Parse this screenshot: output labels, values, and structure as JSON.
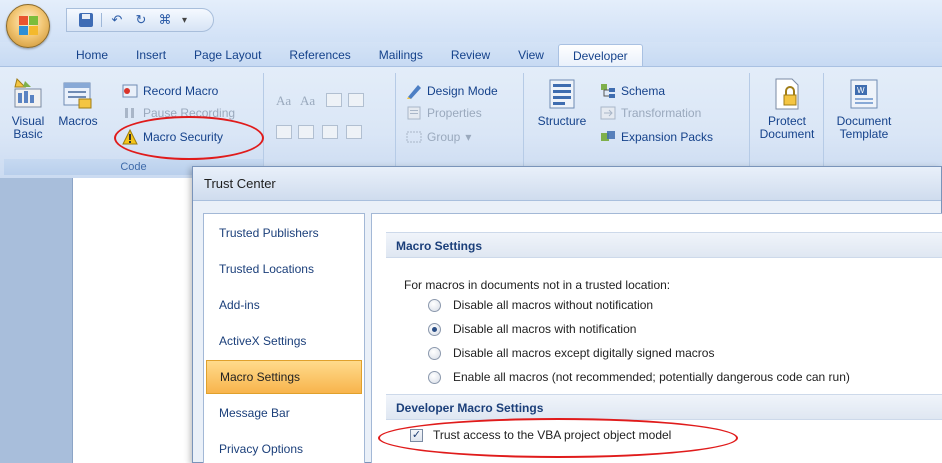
{
  "quick_access": {
    "items": [
      "save-icon",
      "undo-icon",
      "redo-icon",
      "macro-icon"
    ],
    "dropdown": "▾"
  },
  "tabs": [
    "Home",
    "Insert",
    "Page Layout",
    "References",
    "Mailings",
    "Review",
    "View",
    "Developer"
  ],
  "active_tab": "Developer",
  "ribbon": {
    "code": {
      "visual_basic": "Visual Basic",
      "macros": "Macros",
      "record_macro": "Record Macro",
      "pause_recording": "Pause Recording",
      "macro_security": "Macro Security",
      "label": "Code"
    },
    "controls": {
      "design_mode": "Design Mode",
      "properties": "Properties",
      "group": "Group",
      "aa1": "Aa",
      "aa2": "Aa"
    },
    "xml": {
      "structure": "Structure",
      "schema": "Schema",
      "transformation": "Transformation",
      "expansion_packs": "Expansion Packs"
    },
    "protect": {
      "protect_document_line1": "Protect",
      "protect_document_line2": "Document"
    },
    "templates": {
      "document_template_line1": "Document",
      "document_template_line2": "Template"
    }
  },
  "dialog": {
    "title": "Trust Center",
    "nav": [
      "Trusted Publishers",
      "Trusted Locations",
      "Add-ins",
      "ActiveX Settings",
      "Macro Settings",
      "Message Bar",
      "Privacy Options"
    ],
    "selected_nav": "Macro Settings",
    "macro_settings_header": "Macro Settings",
    "macro_settings_desc": "For macros in documents not in a trusted location:",
    "options": [
      "Disable all macros without notification",
      "Disable all macros with notification",
      "Disable all macros except digitally signed macros",
      "Enable all macros (not recommended; potentially dangerous code can run)"
    ],
    "selected_option_index": 1,
    "developer_header": "Developer Macro Settings",
    "trust_vba_label": "Trust access to the VBA project object model",
    "trust_vba_checked": true
  },
  "colors": {
    "highlight": "#e01b1b",
    "selected_nav": "#f8b44c"
  }
}
